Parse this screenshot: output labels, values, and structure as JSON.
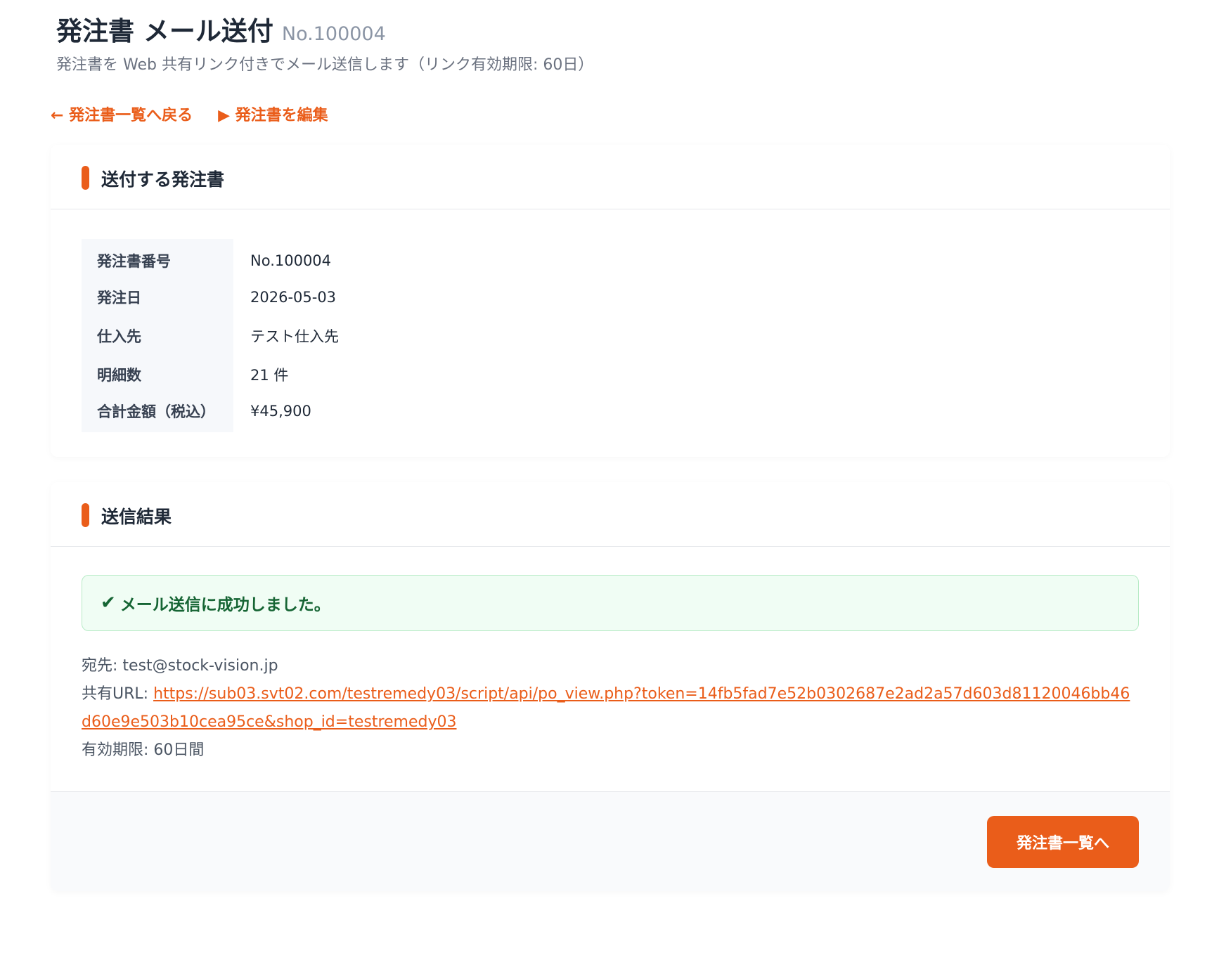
{
  "header": {
    "title": "発注書 メール送付",
    "number": "No.100004",
    "subtitle": "発注書を Web 共有リンク付きでメール送信します（リンク有効期限: 60日）"
  },
  "nav": {
    "back_label": "← 発注書一覧へ戻る",
    "edit_label": "▶ 発注書を編集"
  },
  "order_section": {
    "title": "送付する発注書",
    "rows": [
      {
        "label": "発注書番号",
        "value": "No.100004"
      },
      {
        "label": "発注日",
        "value": "2026-05-03"
      },
      {
        "label": "仕入先",
        "value": "テスト仕入先"
      },
      {
        "label": "明細数",
        "value": "21 件"
      },
      {
        "label": "合計金額（税込）",
        "value": "¥45,900"
      }
    ]
  },
  "result_section": {
    "title": "送信結果",
    "success_icon": "✔",
    "success_message": "メール送信に成功しました。",
    "recipient_label": "宛先: ",
    "recipient": "test@stock-vision.jp",
    "url_label": "共有URL: ",
    "url": "https://sub03.svt02.com/testremedy03/script/api/po_view.php?token=14fb5fad7e52b0302687e2ad2a57d603d81120046bb46d60e9e503b10cea95ce&shop_id=testremedy03",
    "expiry_label": "有効期限: ",
    "expiry": "60日間",
    "button_label": "発注書一覧へ"
  },
  "colors": {
    "accent": "#ea5d1a",
    "success_bg": "#f0fdf4",
    "success_text": "#166534"
  }
}
